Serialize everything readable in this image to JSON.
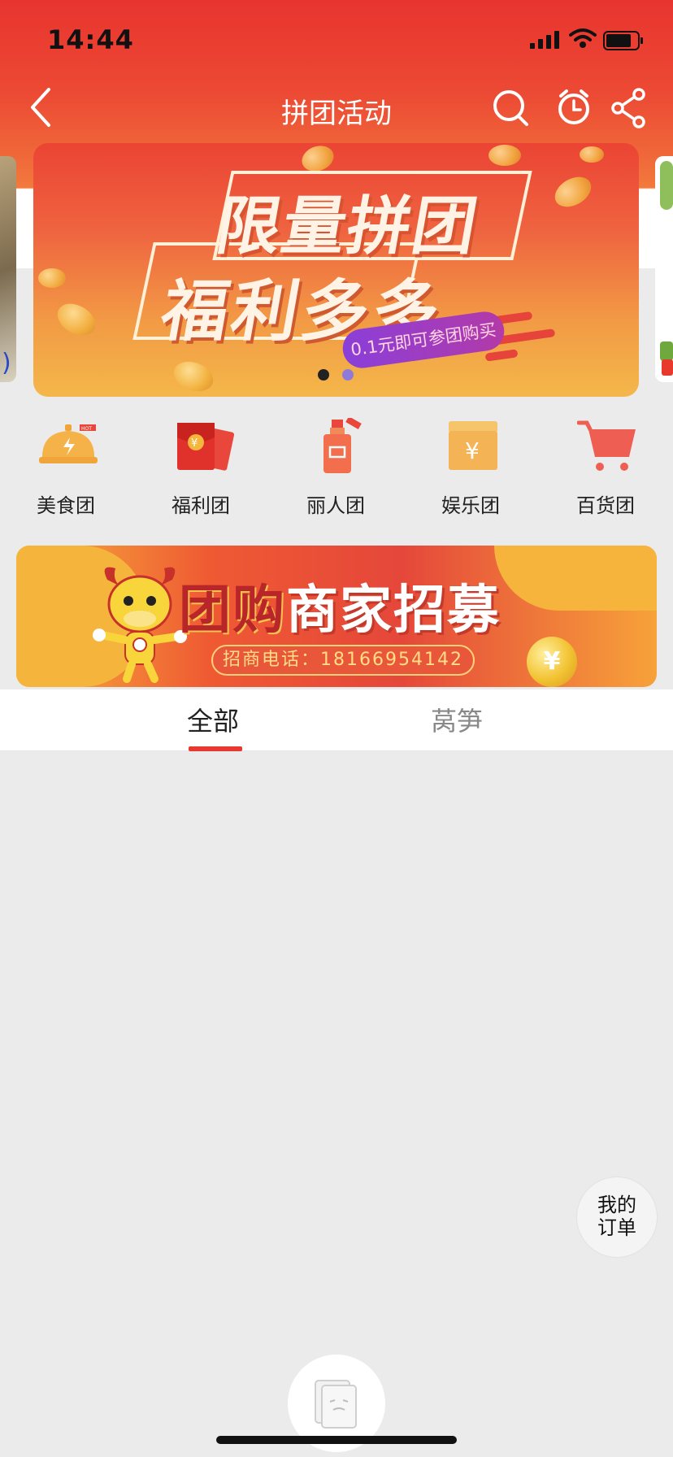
{
  "status_bar": {
    "time": "14:44"
  },
  "navbar": {
    "title": "拼团活动",
    "icons": [
      "back-icon",
      "search-icon",
      "alarm-clock-icon",
      "share-icon"
    ]
  },
  "banner": {
    "line1": "限量拼团",
    "line2": "福利多多",
    "tag": "0.1元即可参团购买",
    "dots": 2,
    "active_dot": 0
  },
  "categories": [
    {
      "label": "美食团",
      "icon": "food-bell-icon",
      "hot": true
    },
    {
      "label": "福利团",
      "icon": "red-envelope-icon",
      "hot": false
    },
    {
      "label": "丽人团",
      "icon": "cosmetics-bottle-icon",
      "hot": true
    },
    {
      "label": "娱乐团",
      "icon": "yuan-box-icon",
      "hot": false
    },
    {
      "label": "百货团",
      "icon": "shopping-cart-icon",
      "hot": false
    }
  ],
  "merchant_banner": {
    "title_a": "团购",
    "title_b": "商家招募",
    "phone": "招商电话：18166954142",
    "coin": "¥"
  },
  "tabs": [
    {
      "label": "全部",
      "active": true
    },
    {
      "label": "莴笋",
      "active": false
    }
  ],
  "floating": {
    "order_line1": "我的",
    "order_line2": "订单"
  },
  "colors": {
    "accent": "#e8382f",
    "header_top": "#e8342f",
    "banner_bottom": "#f4b74a"
  }
}
